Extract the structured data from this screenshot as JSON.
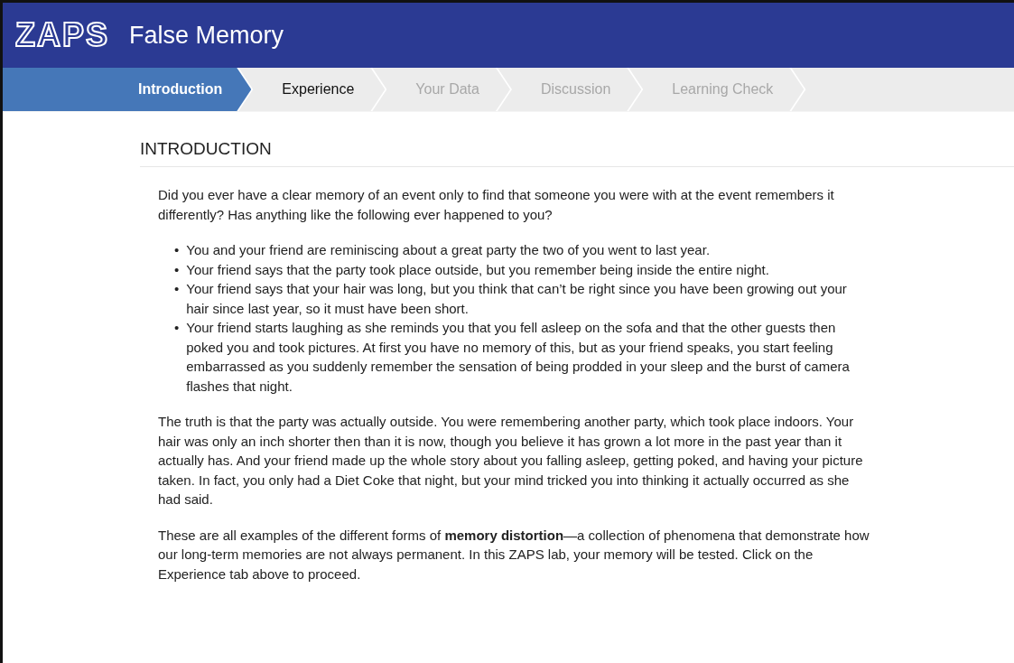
{
  "header": {
    "logo": "ZAPS",
    "title": "False Memory"
  },
  "tabs": [
    {
      "label": "Introduction",
      "selected": true,
      "disabled": false
    },
    {
      "label": "Experience",
      "selected": false,
      "disabled": false
    },
    {
      "label": "Your Data",
      "selected": false,
      "disabled": true
    },
    {
      "label": "Discussion",
      "selected": false,
      "disabled": true
    },
    {
      "label": "Learning Check",
      "selected": false,
      "disabled": true
    }
  ],
  "section": {
    "heading": "INTRODUCTION",
    "intro": "Did you ever have a clear memory of an event only to find that someone you were with at the event remembers it differently? Has anything like the following ever happened to you?",
    "bullet_marker": "•",
    "bullets": [
      "You and your friend are reminiscing about a great party the two of you went to last year.",
      "Your friend says that the party took place outside, but you remember being inside the entire night.",
      "Your friend says that your hair was long, but you think that can’t be right since you have been growing out your hair since last year, so it must have been short.",
      "Your friend starts laughing as she reminds you that you fell asleep on the sofa and that the other guests then poked you and took pictures. At first you have no memory of this, but as your friend speaks, you start feeling embarrassed as you suddenly remember the sensation of being prodded in your sleep and the burst of camera flashes that night."
    ],
    "paragraphs": [
      "The truth is that the party was actually outside. You were remembering another party, which took place indoors. Your hair was only an inch shorter then than it is now, though you believe it has grown a lot more in the past year than it actually has. And your friend made up the whole story about you falling asleep, getting poked, and having your picture taken. In fact, you only had a Diet Coke that night, but your mind tricked you into thinking it actually occurred as she had said.",
      "These are all examples of the different forms of **memory distortion**—a collection of phenomena that demonstrate how our long-term memories are not always permanent. In this ZAPS lab, your memory will be tested. Click on the Experience tab above to proceed."
    ]
  }
}
